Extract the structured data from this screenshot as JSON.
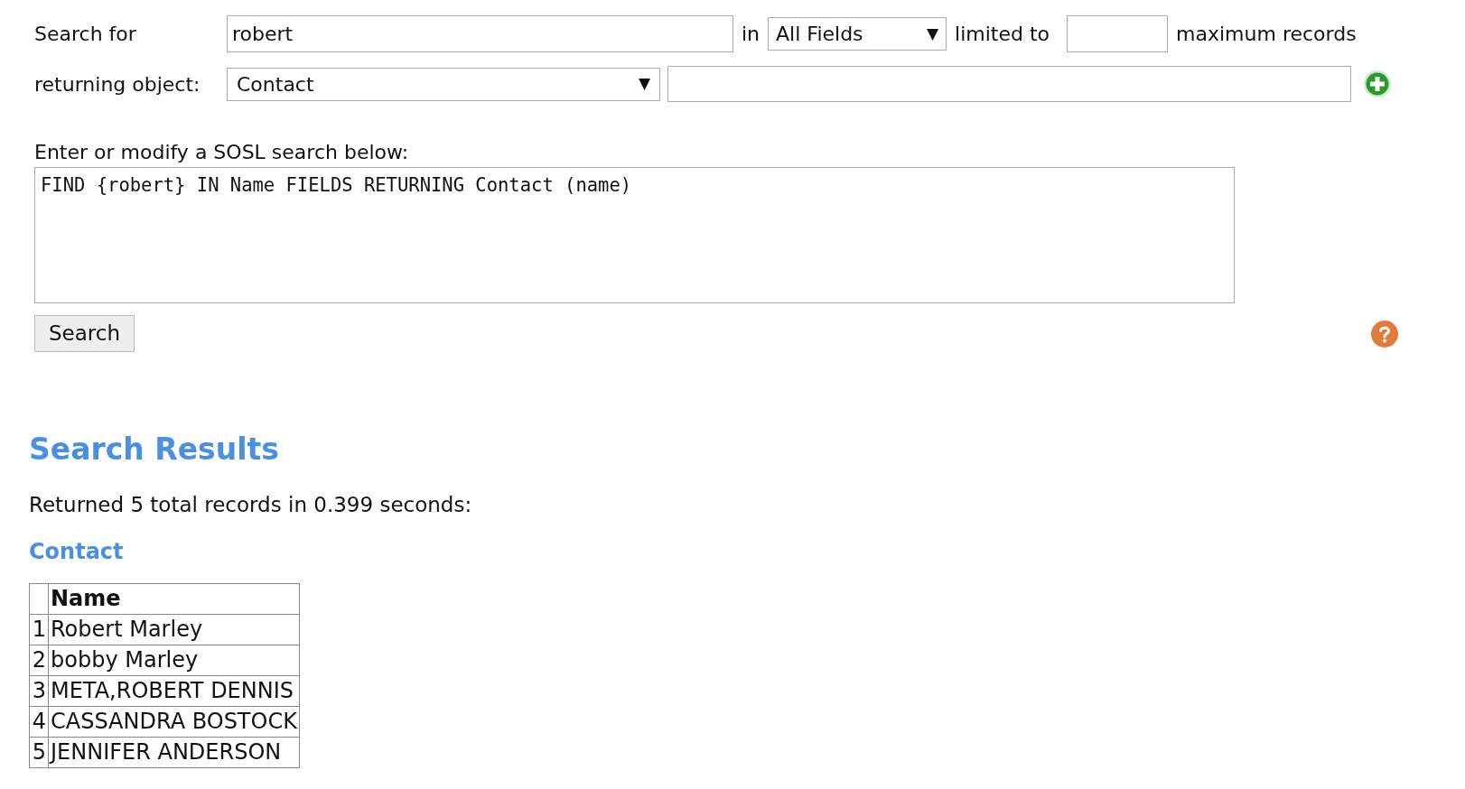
{
  "search_form": {
    "search_for_label": "Search for",
    "search_value": "robert",
    "in_label": "in",
    "fields_select": "All Fields",
    "select_arrow": "▼",
    "limited_to_label": "limited to",
    "max_records_label": "maximum records",
    "returning_label": "returning object:",
    "object_select": "Contact"
  },
  "sosl": {
    "label": "Enter or modify a SOSL search below:",
    "query": "FIND {robert} IN Name FIELDS RETURNING Contact (name)"
  },
  "search_button": "Search",
  "results": {
    "title": "Search Results",
    "summary": "Returned 5 total records in 0.399 seconds:",
    "object_title": "Contact",
    "table": {
      "columns": [
        "Name"
      ],
      "rows": [
        {
          "index": "1",
          "name": "Robert Marley"
        },
        {
          "index": "2",
          "name": "bobby Marley"
        },
        {
          "index": "3",
          "name": "META,ROBERT DENNIS"
        },
        {
          "index": "4",
          "name": "CASSANDRA BOSTOCK"
        },
        {
          "index": "5",
          "name": "JENNIFER ANDERSON"
        }
      ]
    }
  }
}
